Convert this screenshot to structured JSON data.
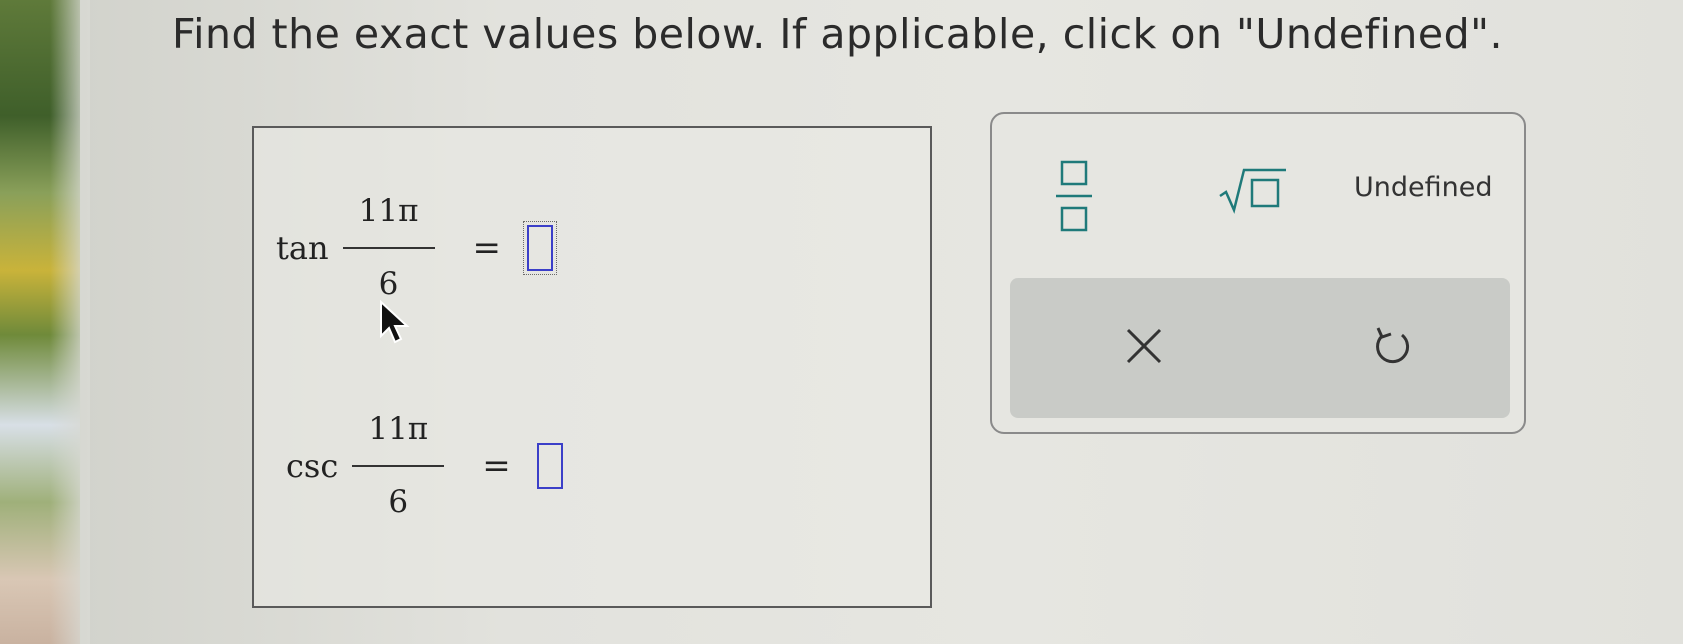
{
  "instruction": "Find the exact values below. If applicable, click on \"Undefined\".",
  "problems": [
    {
      "func": "tan",
      "numerator": "11π",
      "denominator": "6",
      "equals": "="
    },
    {
      "func": "csc",
      "numerator": "11π",
      "denominator": "6",
      "equals": "="
    }
  ],
  "keypad": {
    "undefined_label": "Undefined",
    "clear_symbol": "×",
    "undo_symbol": "↺"
  },
  "colors": {
    "accent_teal": "#1f7a7a",
    "answer_border": "#3b3fc8",
    "panel_gray": "#c9cbc7"
  }
}
